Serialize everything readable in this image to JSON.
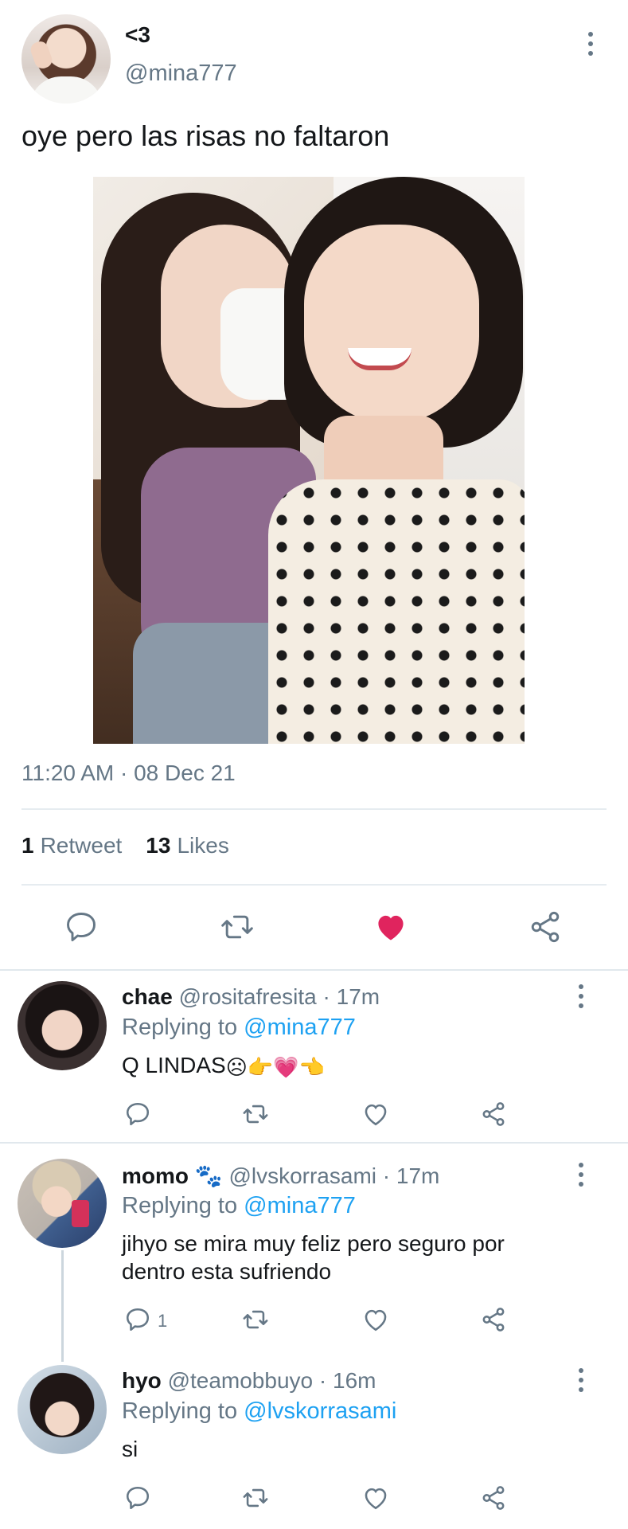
{
  "tweet": {
    "author_name": "<3",
    "author_handle": "@mina777",
    "text": "oye pero las risas no faltaron",
    "timestamp": "11:20 AM · 08 Dec 21",
    "retweets_count": "1",
    "retweets_label": "Retweet",
    "likes_count": "13",
    "likes_label": "Likes",
    "liked": true,
    "like_color": "#e0245e"
  },
  "replies": [
    {
      "name": "chae",
      "handle": "@rositafresita",
      "time": "· 17m",
      "replying_label": "Replying to",
      "replying_to": "@mina777",
      "text": "Q LINDAS",
      "emoji": "☹👉💗👈",
      "reply_count": ""
    },
    {
      "name": "momo 🐾",
      "handle": "@lvskorrasami",
      "time": "· 17m",
      "replying_label": "Replying to",
      "replying_to": "@mina777",
      "text": "jihyo se mira muy feliz pero seguro por dentro esta sufriendo",
      "reply_count": "1"
    },
    {
      "name": "hyo",
      "handle": "@teamobbuyo",
      "time": "· 16m",
      "replying_label": "Replying to",
      "replying_to": "@lvskorrasami",
      "text": "si",
      "reply_count": ""
    }
  ],
  "icons": [
    "more-vertical-icon",
    "reply-icon",
    "retweet-icon",
    "heart-icon",
    "share-icon"
  ],
  "colors": {
    "text_primary": "#14171a",
    "text_secondary": "#657786",
    "link": "#1da1f2"
  }
}
